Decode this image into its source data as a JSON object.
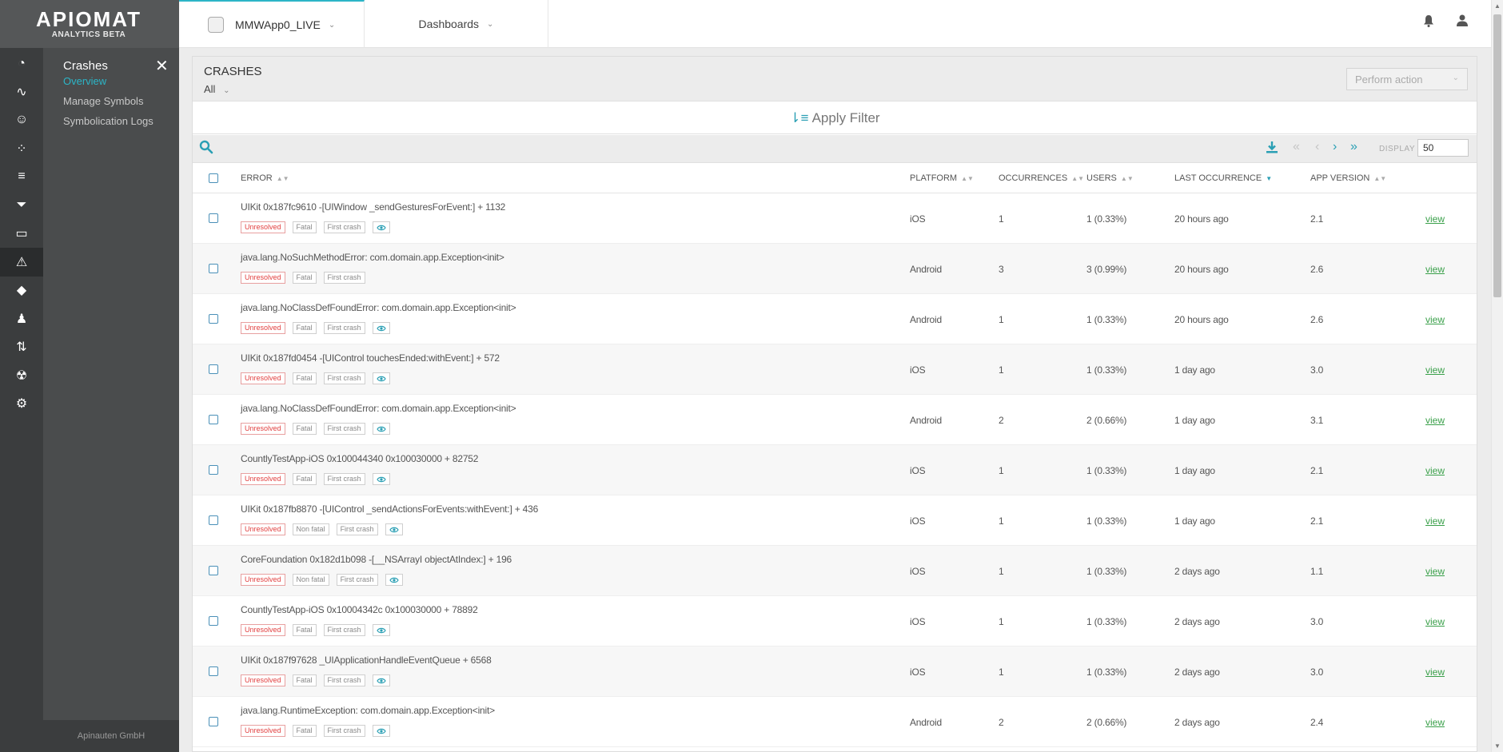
{
  "brand": {
    "logo": "APIOMAT",
    "subtitle": "ANALYTICS BETA"
  },
  "colors": {
    "accent": "#2cb5c7",
    "link": "#3aa04a",
    "unresolved": "#e24040"
  },
  "rail_icons": [
    "dashboard-icon",
    "activity-icon",
    "smiley-icon",
    "bubbles-icon",
    "filter-lines-icon",
    "funnel-icon",
    "card-icon",
    "warning-icon",
    "tag-icon",
    "users-icon",
    "route-icon",
    "radiation-icon",
    "gear-icon"
  ],
  "submenu": {
    "title": "Crashes",
    "close": "✕",
    "items": [
      {
        "label": "Overview",
        "active": true
      },
      {
        "label": "Manage Symbols",
        "active": false
      },
      {
        "label": "Symbolication Logs",
        "active": false
      }
    ]
  },
  "footer": "Apinauten GmbH",
  "header": {
    "app_name": "MMWApp0_LIVE",
    "dashboards": "Dashboards"
  },
  "page": {
    "title": "CRASHES",
    "filter": "All",
    "perform_action": "Perform action",
    "apply_filter": "Apply Filter",
    "display_label": "DISPLAY",
    "display_value": "50"
  },
  "columns": {
    "error": "ERROR",
    "platform": "PLATFORM",
    "occurrences": "OCCURRENCES",
    "users": "USERS",
    "last_occurrence": "LAST OCCURRENCE",
    "app_version": "APP VERSION"
  },
  "tag_labels": {
    "unresolved": "Unresolved",
    "fatal": "Fatal",
    "non_fatal": "Non fatal",
    "first_crash": "First crash"
  },
  "view_label": "view",
  "rows": [
    {
      "error": "UIKit 0x187fc9610 -[UIWindow _sendGesturesForEvent:] + 1132",
      "fatal": "Fatal",
      "eye": true,
      "platform": "iOS",
      "occurrences": "1",
      "users": "1 (0.33%)",
      "last": "20 hours ago",
      "version": "2.1"
    },
    {
      "error": "java.lang.NoSuchMethodError: com.domain.app.Exception<init>",
      "fatal": "Fatal",
      "eye": false,
      "platform": "Android",
      "occurrences": "3",
      "users": "3 (0.99%)",
      "last": "20 hours ago",
      "version": "2.6"
    },
    {
      "error": "java.lang.NoClassDefFoundError: com.domain.app.Exception<init>",
      "fatal": "Fatal",
      "eye": true,
      "platform": "Android",
      "occurrences": "1",
      "users": "1 (0.33%)",
      "last": "20 hours ago",
      "version": "2.6"
    },
    {
      "error": "UIKit 0x187fd0454 -[UIControl touchesEnded:withEvent:] + 572",
      "fatal": "Fatal",
      "eye": true,
      "platform": "iOS",
      "occurrences": "1",
      "users": "1 (0.33%)",
      "last": "1 day ago",
      "version": "3.0"
    },
    {
      "error": "java.lang.NoClassDefFoundError: com.domain.app.Exception<init>",
      "fatal": "Fatal",
      "eye": true,
      "platform": "Android",
      "occurrences": "2",
      "users": "2 (0.66%)",
      "last": "1 day ago",
      "version": "3.1"
    },
    {
      "error": "CountlyTestApp-iOS 0x100044340 0x100030000 + 82752",
      "fatal": "Fatal",
      "eye": true,
      "platform": "iOS",
      "occurrences": "1",
      "users": "1 (0.33%)",
      "last": "1 day ago",
      "version": "2.1"
    },
    {
      "error": "UIKit 0x187fb8870 -[UIControl _sendActionsForEvents:withEvent:] + 436",
      "fatal": "Non fatal",
      "eye": true,
      "platform": "iOS",
      "occurrences": "1",
      "users": "1 (0.33%)",
      "last": "1 day ago",
      "version": "2.1"
    },
    {
      "error": "CoreFoundation 0x182d1b098 -[__NSArrayI objectAtIndex:] + 196",
      "fatal": "Non fatal",
      "eye": true,
      "platform": "iOS",
      "occurrences": "1",
      "users": "1 (0.33%)",
      "last": "2 days ago",
      "version": "1.1"
    },
    {
      "error": "CountlyTestApp-iOS 0x10004342c 0x100030000 + 78892",
      "fatal": "Fatal",
      "eye": true,
      "platform": "iOS",
      "occurrences": "1",
      "users": "1 (0.33%)",
      "last": "2 days ago",
      "version": "3.0"
    },
    {
      "error": "UIKit 0x187f97628 _UIApplicationHandleEventQueue + 6568",
      "fatal": "Fatal",
      "eye": true,
      "platform": "iOS",
      "occurrences": "1",
      "users": "1 (0.33%)",
      "last": "2 days ago",
      "version": "3.0"
    },
    {
      "error": "java.lang.RuntimeException: com.domain.app.Exception<init>",
      "fatal": "Fatal",
      "eye": true,
      "platform": "Android",
      "occurrences": "2",
      "users": "2 (0.66%)",
      "last": "2 days ago",
      "version": "2.4"
    }
  ]
}
